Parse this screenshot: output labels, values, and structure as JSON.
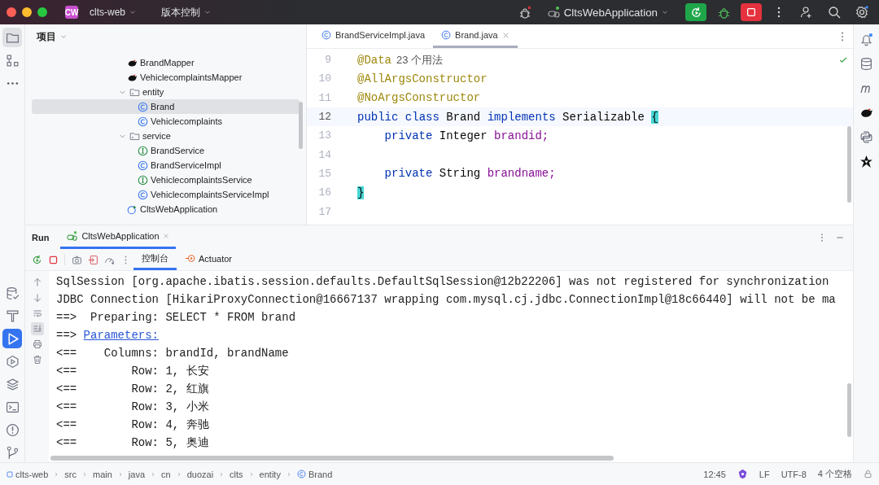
{
  "title_bar": {
    "project_badge": "CW",
    "project": "clts-web",
    "vcs": "版本控制",
    "run_config": "CltsWebApplication"
  },
  "project_panel": {
    "title": "项目",
    "tree": [
      {
        "label": "BrandMapper",
        "kind": "mapper",
        "selected": false
      },
      {
        "label": "VehiclecomplaintsMapper",
        "kind": "mapper",
        "selected": false
      },
      {
        "label": "entity",
        "kind": "folder",
        "expanded": true,
        "selected": false,
        "children": [
          {
            "label": "Brand",
            "kind": "class",
            "selected": true
          },
          {
            "label": "Vehiclecomplaints",
            "kind": "class",
            "selected": false
          }
        ]
      },
      {
        "label": "service",
        "kind": "folder",
        "expanded": true,
        "selected": false,
        "children": [
          {
            "label": "BrandService",
            "kind": "interface",
            "selected": false
          },
          {
            "label": "BrandServiceImpl",
            "kind": "class",
            "selected": false
          },
          {
            "label": "VehiclecomplaintsService",
            "kind": "interface",
            "selected": false
          },
          {
            "label": "VehiclecomplaintsServiceImpl",
            "kind": "class",
            "selected": false
          }
        ]
      },
      {
        "label": "CltsWebApplication",
        "kind": "app",
        "selected": false
      }
    ]
  },
  "editor": {
    "tabs": [
      {
        "label": "BrandServiceImpl.java",
        "selected": false
      },
      {
        "label": "Brand.java",
        "selected": true
      }
    ],
    "lines": [
      {
        "number": "9",
        "current": false,
        "tokens": [
          {
            "kind": "annotation",
            "t": "@Data"
          },
          {
            "kind": "hint",
            "t": "23 个用法"
          }
        ]
      },
      {
        "number": "10",
        "current": false,
        "tokens": [
          {
            "kind": "annotation",
            "t": "@AllArgsConstructor"
          }
        ]
      },
      {
        "number": "11",
        "current": false,
        "tokens": [
          {
            "kind": "annotation",
            "t": "@NoArgsConstructor"
          }
        ]
      },
      {
        "number": "12",
        "current": true,
        "tokens": [
          {
            "kind": "keyword",
            "t": "public"
          },
          {
            "kind": "keyword",
            "t": "class"
          },
          {
            "kind": "plain",
            "t": "Brand"
          },
          {
            "kind": "keyword",
            "t": "implements"
          },
          {
            "kind": "plain",
            "t": "Serializable"
          },
          {
            "kind": "brace",
            "t": "{"
          }
        ]
      },
      {
        "number": "13",
        "current": false,
        "indent": true,
        "tokens": [
          {
            "kind": "keyword",
            "t": "private"
          },
          {
            "kind": "plain",
            "t": "Integer"
          },
          {
            "kind": "field",
            "t": "brandid;"
          }
        ]
      },
      {
        "number": "14",
        "current": false
      },
      {
        "number": "15",
        "current": false,
        "indent": true,
        "tokens": [
          {
            "kind": "keyword",
            "t": "private"
          },
          {
            "kind": "plain",
            "t": "String"
          },
          {
            "kind": "field",
            "t": "brandname;"
          }
        ]
      },
      {
        "number": "16",
        "current": false,
        "tokens": [
          {
            "kind": "brace",
            "t": "}"
          }
        ]
      },
      {
        "number": "17",
        "current": false
      }
    ]
  },
  "run_panel": {
    "title": "Run",
    "tabs": [
      {
        "label": "CltsWebApplication",
        "selected": true
      }
    ],
    "console_tabs": [
      {
        "label": "控制台",
        "selected": true
      },
      {
        "label": "Actuator",
        "selected": false
      }
    ],
    "console": [
      [
        {
          "t": "SqlSession [org.apache.ibatis.session.defaults.DefaultSqlSession@12b22206] was not registered for synchronization"
        }
      ],
      [
        {
          "t": "JDBC Connection [HikariProxyConnection@16667137 wrapping com.mysql.cj.jdbc.ConnectionImpl@18c66440] will not be ma"
        }
      ],
      [
        {
          "t": "==>  Preparing: SELECT * FROM brand"
        }
      ],
      [
        {
          "t": "==> "
        },
        {
          "t": "Parameters:",
          "kind": "link"
        }
      ],
      [
        {
          "t": "<==    Columns: brandId, brandName"
        }
      ],
      [
        {
          "t": "<==        Row: 1, 长安"
        }
      ],
      [
        {
          "t": "<==        Row: 2, 红旗"
        }
      ],
      [
        {
          "t": "<==        Row: 3, 小米"
        }
      ],
      [
        {
          "t": "<==        Row: 4, 奔驰"
        }
      ],
      [
        {
          "t": "<==        Row: 5, 奥迪"
        }
      ]
    ]
  },
  "status_bar": {
    "breadcrumbs": [
      "clts-web",
      "src",
      "main",
      "java",
      "cn",
      "duozai",
      "clts",
      "entity",
      "Brand"
    ],
    "position": "12:45",
    "line_ending": "LF",
    "encoding": "UTF-8",
    "indent": "4 个空格"
  }
}
